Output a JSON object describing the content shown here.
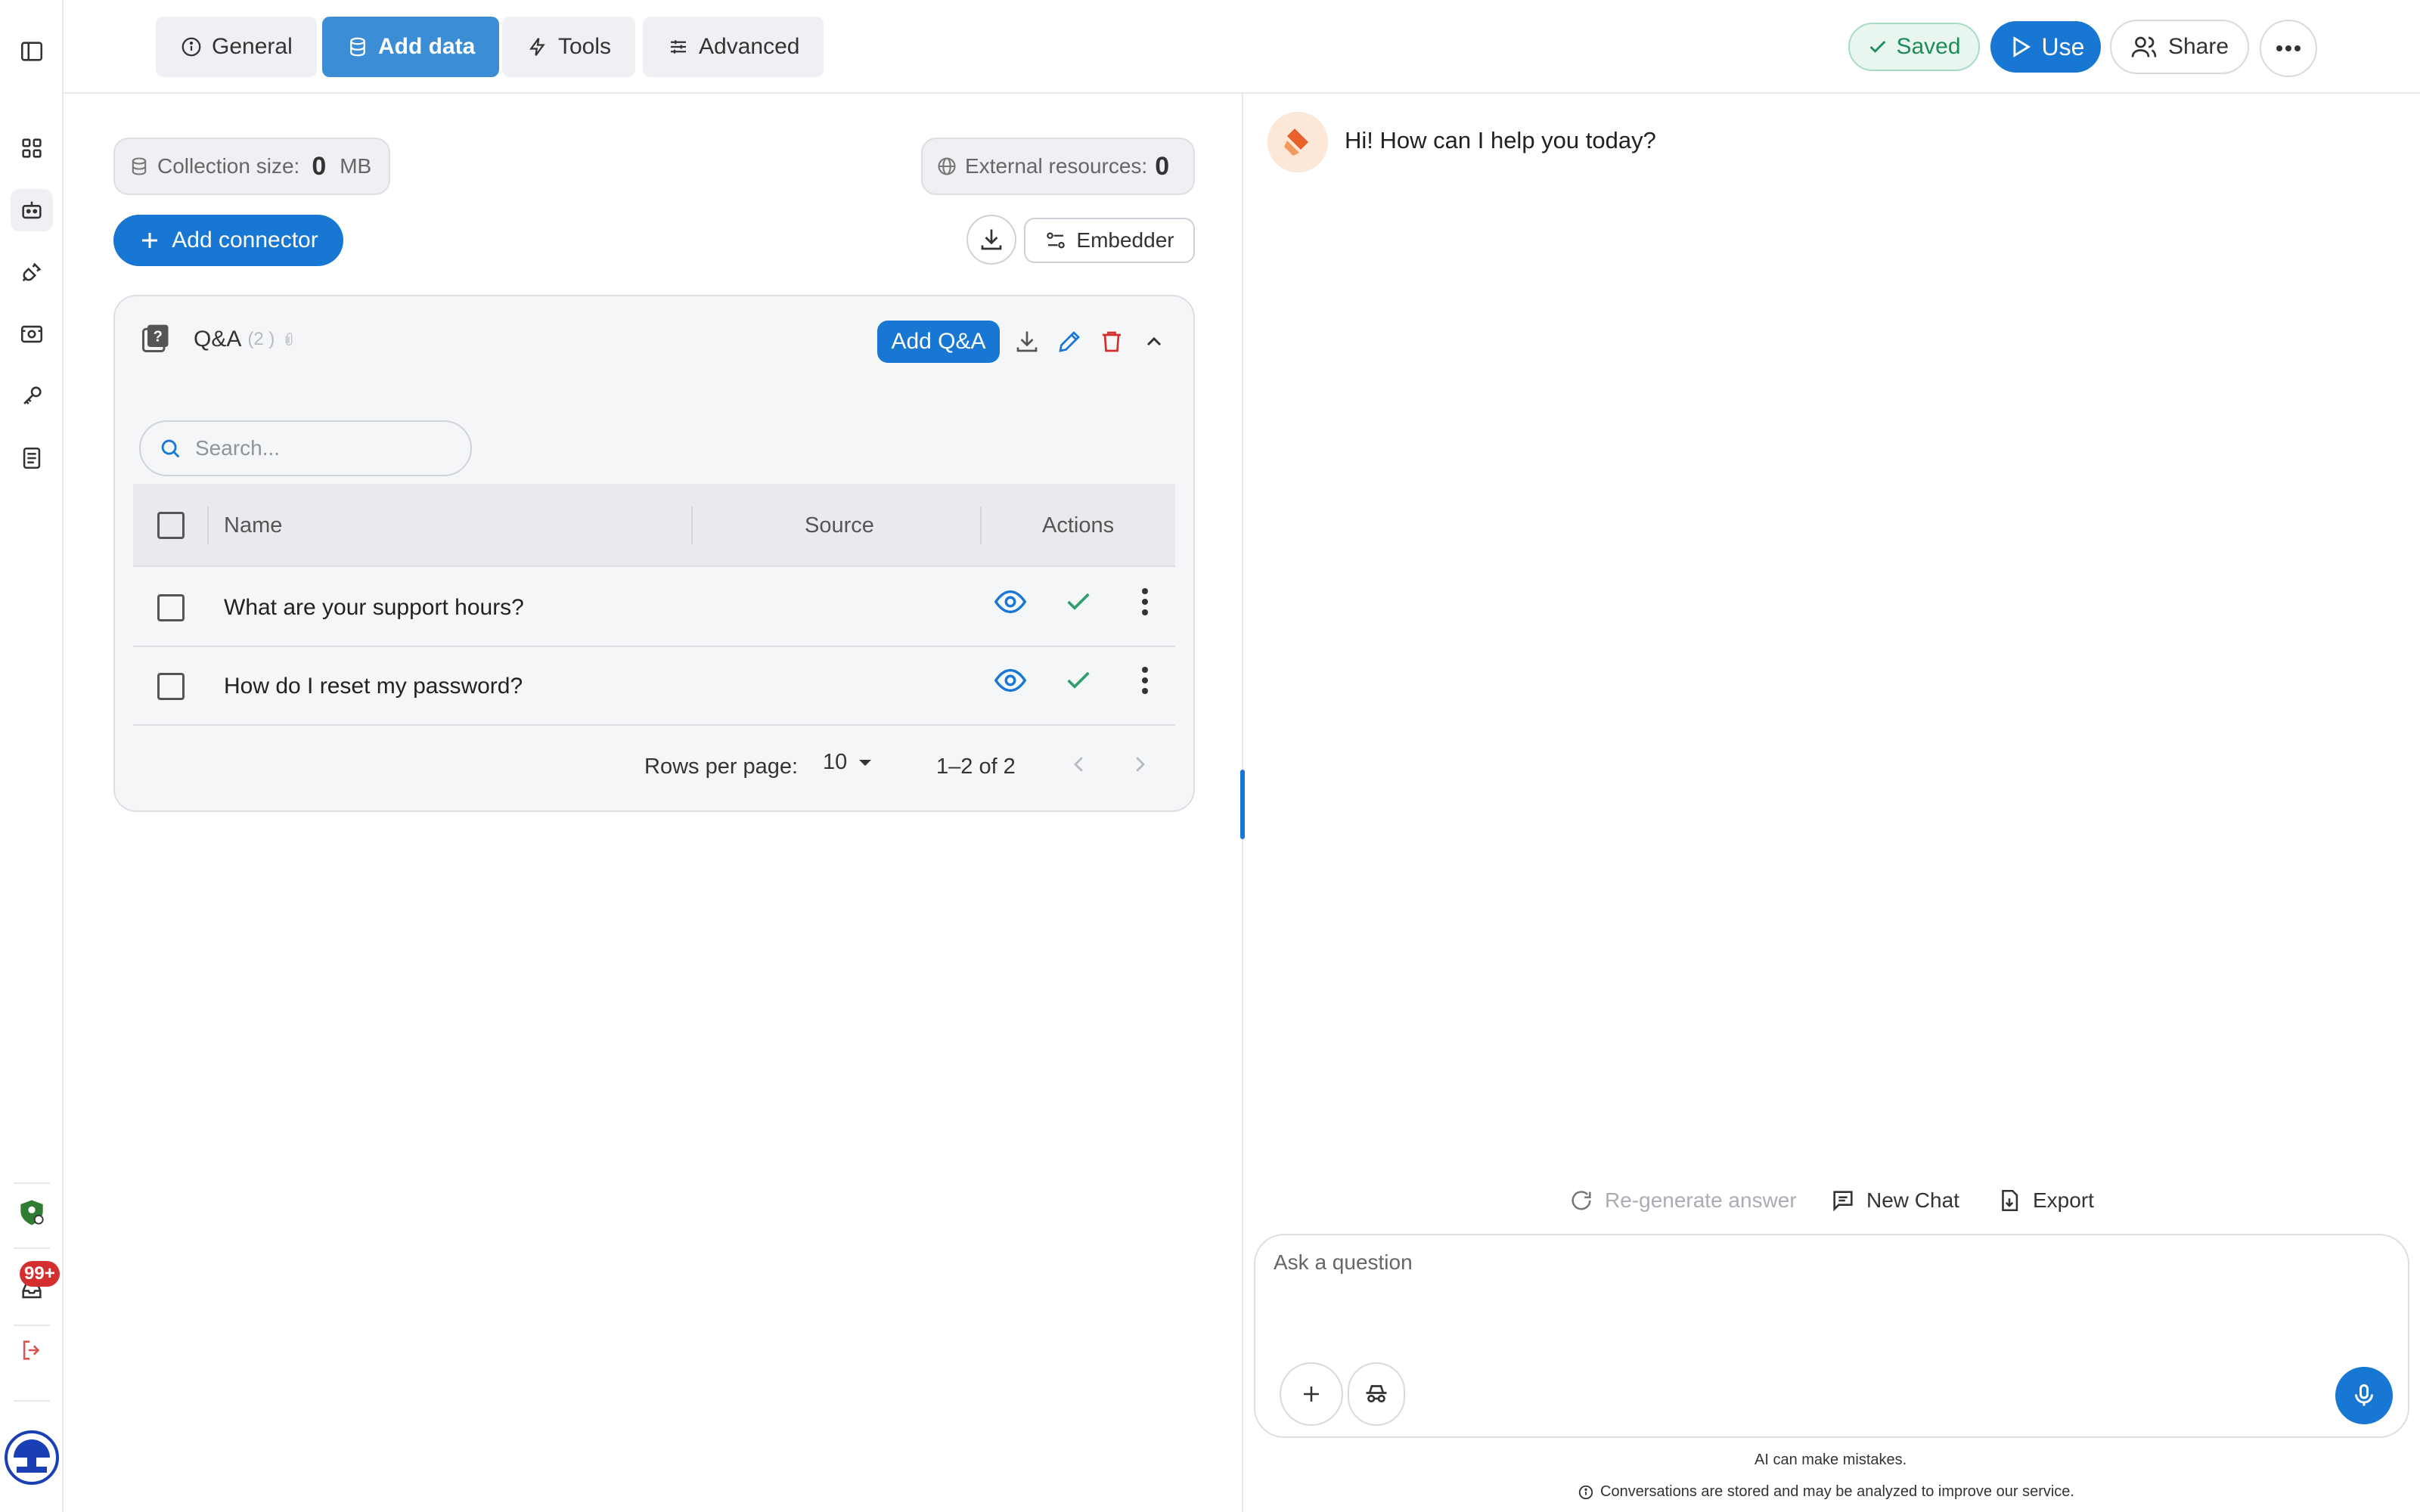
{
  "rail": {
    "icons": [
      "sidebar-toggle-icon",
      "dashboard-grid-icon",
      "bot-icon",
      "plug-icon",
      "scan-icon",
      "key-icon",
      "document-icon",
      "team-icon",
      "inbox-icon",
      "logout-icon",
      "profile-avatar"
    ],
    "inbox_badge": "99+"
  },
  "tabs": [
    {
      "label": "General",
      "icon": "info-icon"
    },
    {
      "label": "Add data",
      "icon": "database-icon"
    },
    {
      "label": "Tools",
      "icon": "lightning-icon"
    },
    {
      "label": "Advanced",
      "icon": "sliders-icon"
    }
  ],
  "header": {
    "saved_label": "Saved",
    "use_label": "Use",
    "share_label": "Share"
  },
  "data_panel": {
    "collection_size_label": "Collection size:",
    "collection_size_value": "0",
    "collection_size_unit": "MB",
    "external_label": "External resources:",
    "external_value": "0",
    "add_connector_label": "Add connector",
    "embedder_label": "Embedder"
  },
  "qa": {
    "title": "Q&A",
    "count": "(2 )",
    "add_label": "Add Q&A",
    "search_placeholder": "Search...",
    "columns": [
      "Name",
      "Source",
      "Actions"
    ],
    "rows": [
      {
        "name": "What are your support hours?"
      },
      {
        "name": "How do I reset my password?"
      }
    ],
    "rows_per_page_label": "Rows per page:",
    "rows_per_page_value": "10",
    "range": "1–2 of 2"
  },
  "chat": {
    "greeting": "Hi! How can I help you today?",
    "regenerate_label": "Re-generate answer",
    "new_chat_label": "New Chat",
    "export_label": "Export",
    "input_placeholder": "Ask a question",
    "disclaimer": "AI can make mistakes.",
    "privacy_note": "Conversations are stored and may be analyzed to improve our service."
  },
  "colors": {
    "accent": "#1877d2",
    "active_tab": "#3b8ed6",
    "saved_green": "#1f8b57",
    "delete_red": "#d32f2f",
    "check_green": "#2e9e6b"
  }
}
